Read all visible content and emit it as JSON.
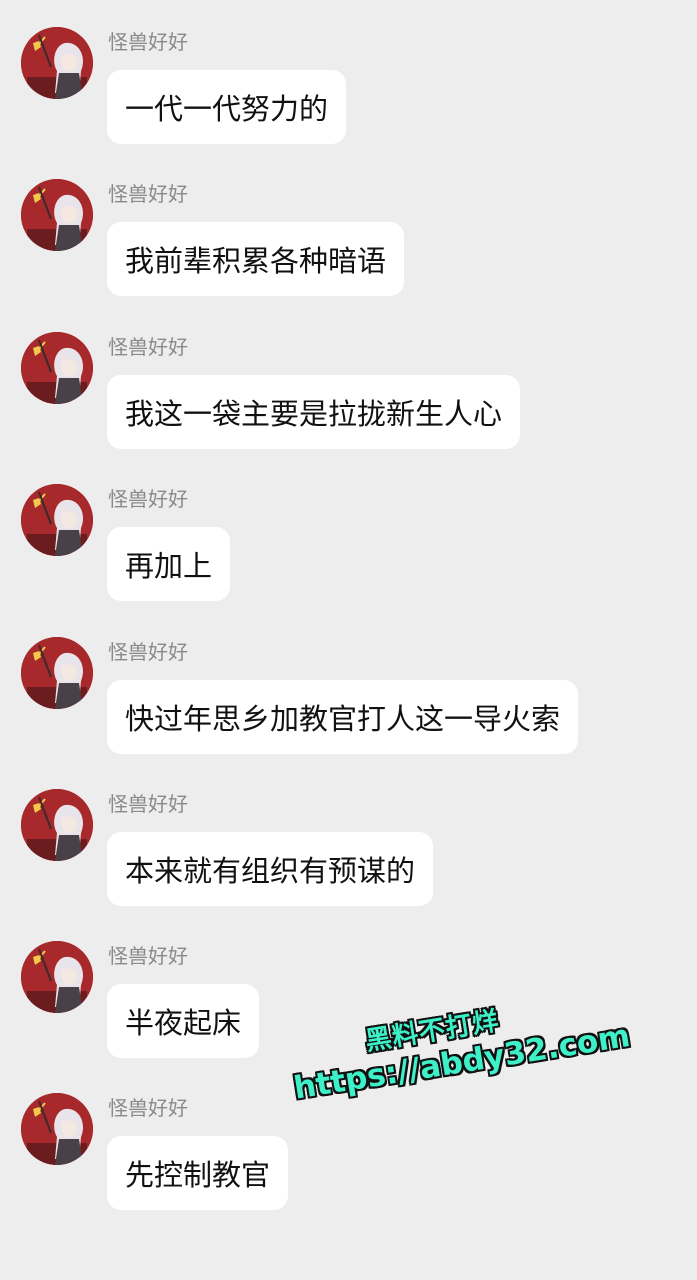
{
  "sender_name": "怪兽好好",
  "messages": [
    {
      "text": "一代一代努力的"
    },
    {
      "text": "我前辈积累各种暗语"
    },
    {
      "text": "我这一袋主要是拉拢新生人心"
    },
    {
      "text": "再加上"
    },
    {
      "text": "快过年思乡加教官打人这一导火索"
    },
    {
      "text": "本来就有组织有预谋的"
    },
    {
      "text": "半夜起床"
    },
    {
      "text": "先控制教官"
    }
  ],
  "watermark": {
    "line1": "黑料不打烊",
    "line2": "https://abdy32.com",
    "color": "#3df0c8"
  },
  "colors": {
    "background": "#ededed",
    "bubble": "#ffffff",
    "avatar_bg": "#a8292b",
    "sender_text": "#8a8a8a"
  }
}
